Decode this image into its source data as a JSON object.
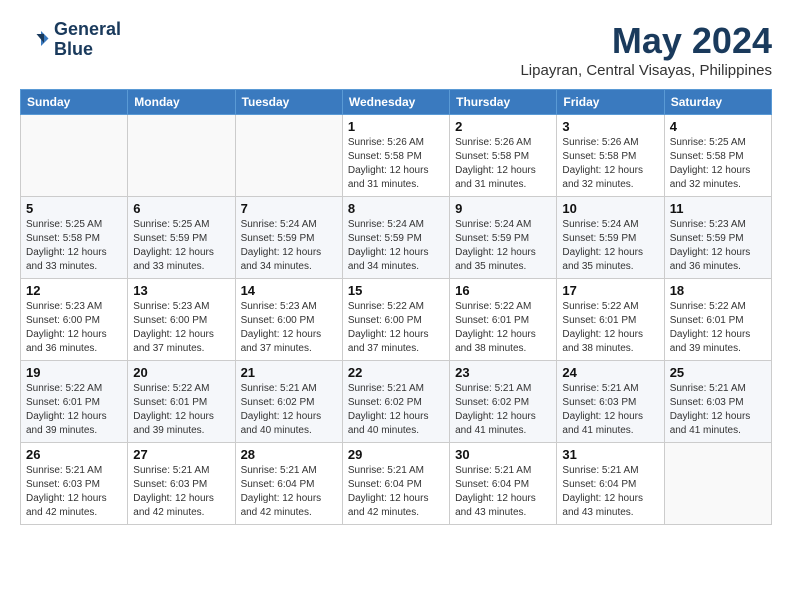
{
  "header": {
    "logo_line1": "General",
    "logo_line2": "Blue",
    "month_title": "May 2024",
    "location": "Lipayran, Central Visayas, Philippines"
  },
  "days": [
    "Sunday",
    "Monday",
    "Tuesday",
    "Wednesday",
    "Thursday",
    "Friday",
    "Saturday"
  ],
  "weeks": [
    {
      "cells": [
        {
          "date": "",
          "info": ""
        },
        {
          "date": "",
          "info": ""
        },
        {
          "date": "",
          "info": ""
        },
        {
          "date": "1",
          "info": "Sunrise: 5:26 AM\nSunset: 5:58 PM\nDaylight: 12 hours\nand 31 minutes."
        },
        {
          "date": "2",
          "info": "Sunrise: 5:26 AM\nSunset: 5:58 PM\nDaylight: 12 hours\nand 31 minutes."
        },
        {
          "date": "3",
          "info": "Sunrise: 5:26 AM\nSunset: 5:58 PM\nDaylight: 12 hours\nand 32 minutes."
        },
        {
          "date": "4",
          "info": "Sunrise: 5:25 AM\nSunset: 5:58 PM\nDaylight: 12 hours\nand 32 minutes."
        }
      ]
    },
    {
      "cells": [
        {
          "date": "5",
          "info": "Sunrise: 5:25 AM\nSunset: 5:58 PM\nDaylight: 12 hours\nand 33 minutes."
        },
        {
          "date": "6",
          "info": "Sunrise: 5:25 AM\nSunset: 5:59 PM\nDaylight: 12 hours\nand 33 minutes."
        },
        {
          "date": "7",
          "info": "Sunrise: 5:24 AM\nSunset: 5:59 PM\nDaylight: 12 hours\nand 34 minutes."
        },
        {
          "date": "8",
          "info": "Sunrise: 5:24 AM\nSunset: 5:59 PM\nDaylight: 12 hours\nand 34 minutes."
        },
        {
          "date": "9",
          "info": "Sunrise: 5:24 AM\nSunset: 5:59 PM\nDaylight: 12 hours\nand 35 minutes."
        },
        {
          "date": "10",
          "info": "Sunrise: 5:24 AM\nSunset: 5:59 PM\nDaylight: 12 hours\nand 35 minutes."
        },
        {
          "date": "11",
          "info": "Sunrise: 5:23 AM\nSunset: 5:59 PM\nDaylight: 12 hours\nand 36 minutes."
        }
      ]
    },
    {
      "cells": [
        {
          "date": "12",
          "info": "Sunrise: 5:23 AM\nSunset: 6:00 PM\nDaylight: 12 hours\nand 36 minutes."
        },
        {
          "date": "13",
          "info": "Sunrise: 5:23 AM\nSunset: 6:00 PM\nDaylight: 12 hours\nand 37 minutes."
        },
        {
          "date": "14",
          "info": "Sunrise: 5:23 AM\nSunset: 6:00 PM\nDaylight: 12 hours\nand 37 minutes."
        },
        {
          "date": "15",
          "info": "Sunrise: 5:22 AM\nSunset: 6:00 PM\nDaylight: 12 hours\nand 37 minutes."
        },
        {
          "date": "16",
          "info": "Sunrise: 5:22 AM\nSunset: 6:01 PM\nDaylight: 12 hours\nand 38 minutes."
        },
        {
          "date": "17",
          "info": "Sunrise: 5:22 AM\nSunset: 6:01 PM\nDaylight: 12 hours\nand 38 minutes."
        },
        {
          "date": "18",
          "info": "Sunrise: 5:22 AM\nSunset: 6:01 PM\nDaylight: 12 hours\nand 39 minutes."
        }
      ]
    },
    {
      "cells": [
        {
          "date": "19",
          "info": "Sunrise: 5:22 AM\nSunset: 6:01 PM\nDaylight: 12 hours\nand 39 minutes."
        },
        {
          "date": "20",
          "info": "Sunrise: 5:22 AM\nSunset: 6:01 PM\nDaylight: 12 hours\nand 39 minutes."
        },
        {
          "date": "21",
          "info": "Sunrise: 5:21 AM\nSunset: 6:02 PM\nDaylight: 12 hours\nand 40 minutes."
        },
        {
          "date": "22",
          "info": "Sunrise: 5:21 AM\nSunset: 6:02 PM\nDaylight: 12 hours\nand 40 minutes."
        },
        {
          "date": "23",
          "info": "Sunrise: 5:21 AM\nSunset: 6:02 PM\nDaylight: 12 hours\nand 41 minutes."
        },
        {
          "date": "24",
          "info": "Sunrise: 5:21 AM\nSunset: 6:03 PM\nDaylight: 12 hours\nand 41 minutes."
        },
        {
          "date": "25",
          "info": "Sunrise: 5:21 AM\nSunset: 6:03 PM\nDaylight: 12 hours\nand 41 minutes."
        }
      ]
    },
    {
      "cells": [
        {
          "date": "26",
          "info": "Sunrise: 5:21 AM\nSunset: 6:03 PM\nDaylight: 12 hours\nand 42 minutes."
        },
        {
          "date": "27",
          "info": "Sunrise: 5:21 AM\nSunset: 6:03 PM\nDaylight: 12 hours\nand 42 minutes."
        },
        {
          "date": "28",
          "info": "Sunrise: 5:21 AM\nSunset: 6:04 PM\nDaylight: 12 hours\nand 42 minutes."
        },
        {
          "date": "29",
          "info": "Sunrise: 5:21 AM\nSunset: 6:04 PM\nDaylight: 12 hours\nand 42 minutes."
        },
        {
          "date": "30",
          "info": "Sunrise: 5:21 AM\nSunset: 6:04 PM\nDaylight: 12 hours\nand 43 minutes."
        },
        {
          "date": "31",
          "info": "Sunrise: 5:21 AM\nSunset: 6:04 PM\nDaylight: 12 hours\nand 43 minutes."
        },
        {
          "date": "",
          "info": ""
        }
      ]
    }
  ]
}
